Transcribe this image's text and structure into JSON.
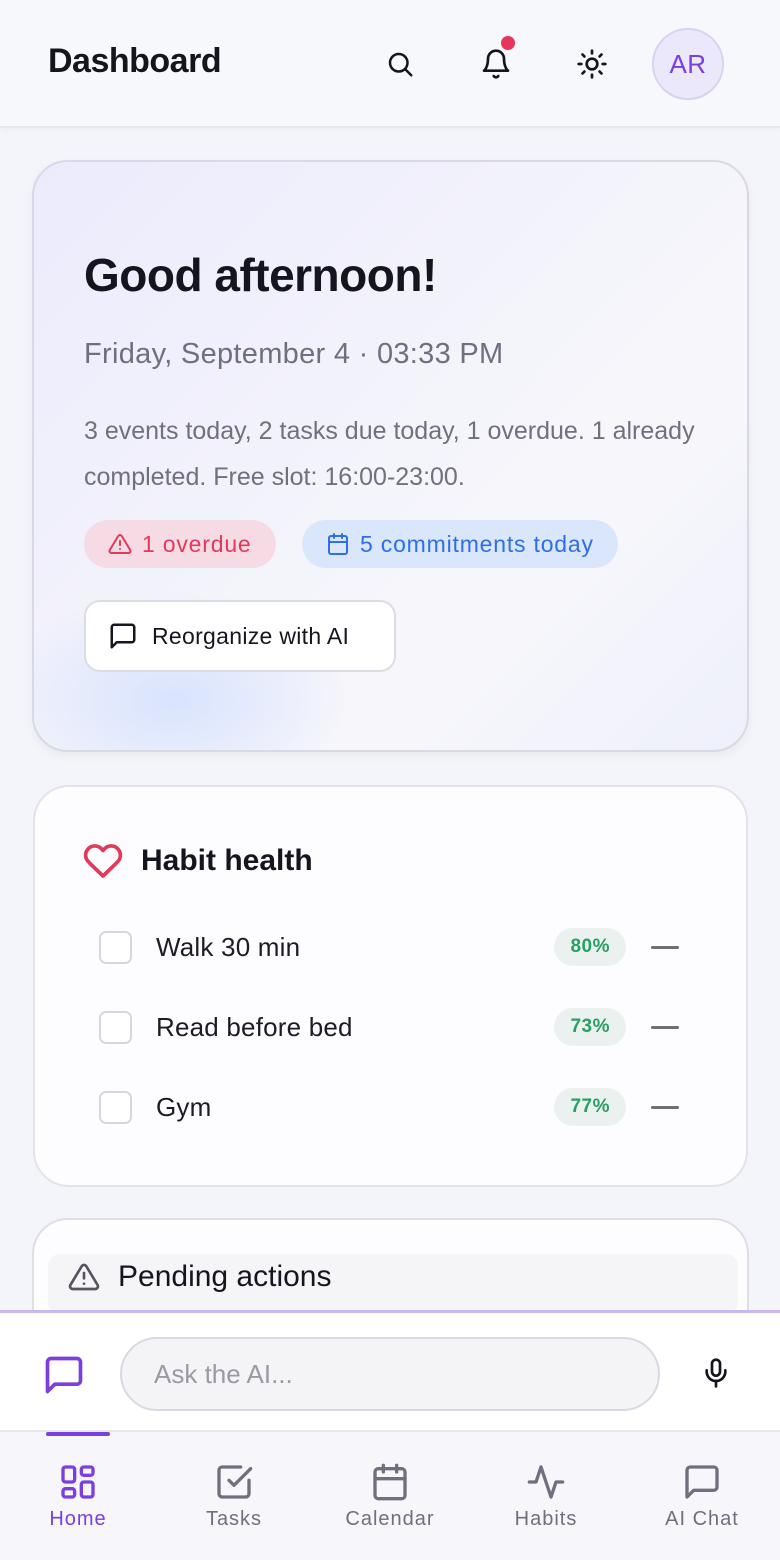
{
  "header": {
    "title": "Dashboard",
    "avatar_initials": "AR",
    "icons": [
      "search-icon",
      "bell-icon",
      "sun-icon"
    ]
  },
  "greeting": {
    "title": "Good afternoon!",
    "date": "Friday, September 4 · 03:33 PM",
    "summary": "3 events today, 2 tasks due today, 1 overdue. 1 already completed. Free slot: 16:00-23:00.",
    "chip_overdue": "1 overdue",
    "chip_commitments": "5 commitments today",
    "reorganize_label": "Reorganize with AI"
  },
  "habits": {
    "title": "Habit health",
    "items": [
      {
        "name": "Walk 30 min",
        "percent": "80%"
      },
      {
        "name": "Read before bed",
        "percent": "73%"
      },
      {
        "name": "Gym",
        "percent": "77%"
      }
    ]
  },
  "pending": {
    "title": "Pending actions"
  },
  "composer": {
    "placeholder": "Ask the AI..."
  },
  "nav": {
    "items": [
      {
        "label": "Home",
        "icon": "grid-icon",
        "active": true
      },
      {
        "label": "Tasks",
        "icon": "checkbox-icon",
        "active": false
      },
      {
        "label": "Calendar",
        "icon": "calendar-icon",
        "active": false
      },
      {
        "label": "Habits",
        "icon": "activity-icon",
        "active": false
      },
      {
        "label": "AI Chat",
        "icon": "chat-icon",
        "active": false
      }
    ]
  },
  "colors": {
    "accent": "#7b3fe0",
    "danger": "#e23a5c",
    "info": "#2f6fe6",
    "success": "#27a064",
    "notification_dot": "#e8355d"
  }
}
